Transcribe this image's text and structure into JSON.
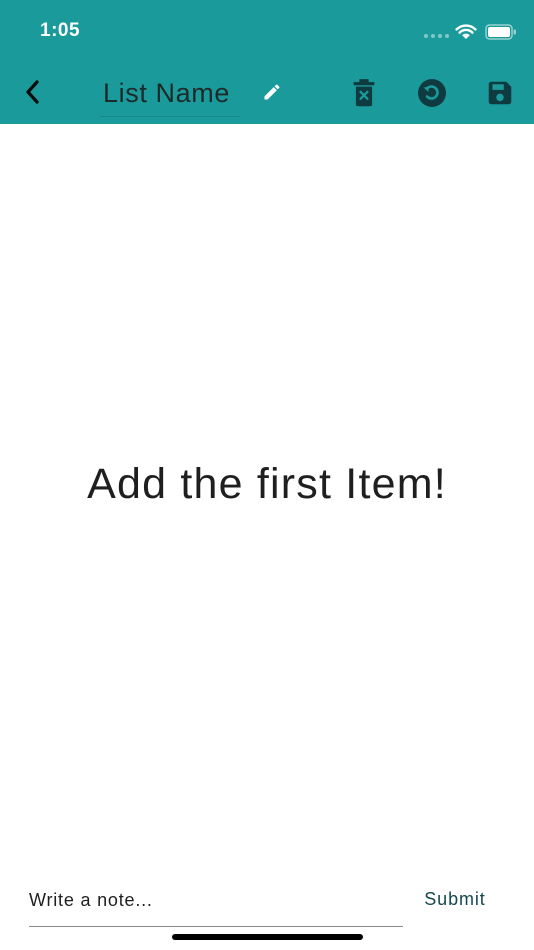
{
  "status_bar": {
    "time": "1:05",
    "icons": [
      "cell-signal-icon",
      "wifi-icon",
      "battery-icon"
    ]
  },
  "app_bar": {
    "back_icon": "chevron-left-icon",
    "list_name": "List Name",
    "edit_icon": "pencil-icon",
    "actions": [
      "delete-list-icon",
      "reset-icon",
      "save-icon"
    ]
  },
  "main": {
    "empty_message": "Add the first Item!"
  },
  "composer": {
    "note_placeholder": "Write a note...",
    "submit_label": "Submit"
  },
  "colors": {
    "header": "#1a9a9a",
    "icon": "#0f3a40",
    "submit_text": "#14484c",
    "background": "#ffffff"
  }
}
